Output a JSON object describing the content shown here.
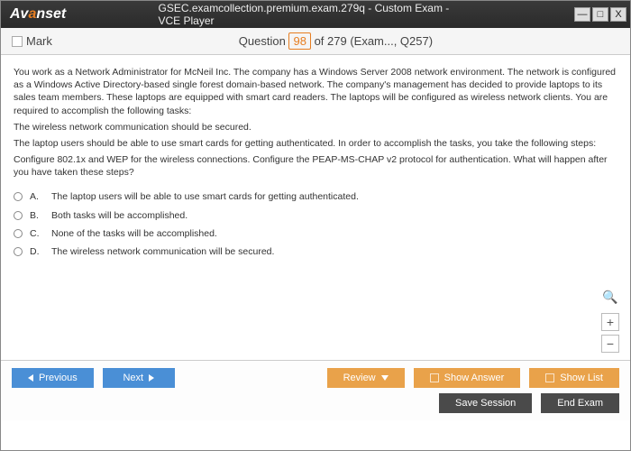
{
  "window": {
    "logo_pre": "Av",
    "logo_mid": "a",
    "logo_post": "nset",
    "title": "GSEC.examcollection.premium.exam.279q - Custom Exam - VCE Player",
    "min": "—",
    "max": "□",
    "close": "X"
  },
  "header": {
    "mark": "Mark",
    "q_word": "Question",
    "q_num": "98",
    "q_rest": " of 279 (Exam..., Q257)"
  },
  "question": {
    "p1": "You work as a Network Administrator for McNeil Inc. The company has a Windows Server 2008 network environment. The network is configured as a Windows Active Directory-based single forest domain-based network. The company's management has decided to provide laptops to its sales team members. These laptops are equipped with smart card readers. The laptops will be configured as wireless network clients. You are required to accomplish the following tasks:",
    "p2": "The wireless network communication should be secured.",
    "p3": "The laptop users should be able to use smart cards for getting authenticated. In order to accomplish the tasks, you take the following steps:",
    "p4": "Configure 802.1x and WEP for the wireless connections. Configure the PEAP-MS-CHAP v2 protocol for authentication. What will happen after you have taken these steps?",
    "opts": [
      {
        "l": "A.",
        "t": "The laptop users will be able to use smart cards for getting authenticated."
      },
      {
        "l": "B.",
        "t": "Both tasks will be accomplished."
      },
      {
        "l": "C.",
        "t": "None of the tasks will be accomplished."
      },
      {
        "l": "D.",
        "t": "The wireless network communication will be secured."
      }
    ]
  },
  "zoom": {
    "plus": "+",
    "minus": "−",
    "mag": "🔍"
  },
  "footer": {
    "prev": "Previous",
    "next": "Next",
    "review": "Review",
    "showans": "Show Answer",
    "showlist": "Show List",
    "save": "Save Session",
    "end": "End Exam"
  }
}
